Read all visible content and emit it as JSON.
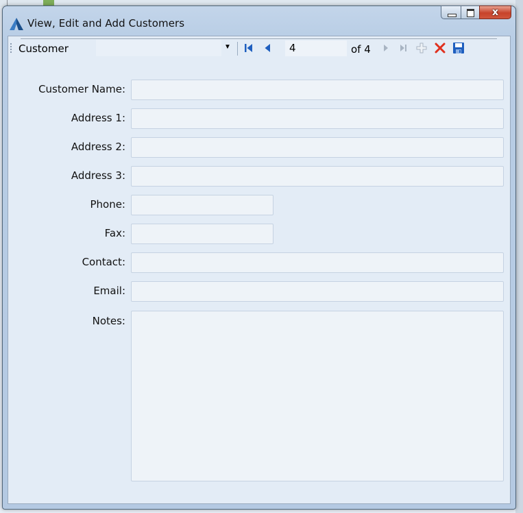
{
  "window": {
    "title": "View, Edit and Add Customers",
    "close_glyph": "x"
  },
  "toolbar": {
    "selector_value": "Customer",
    "position_value": "4",
    "of_label": "of 4",
    "icons": [
      "move-first-icon",
      "move-previous-icon",
      "move-next-icon",
      "move-last-icon",
      "add-new-icon",
      "delete-icon",
      "save-icon"
    ]
  },
  "form": {
    "customer_name": {
      "label": "Customer Name:",
      "value": ""
    },
    "address1": {
      "label": "Address 1:",
      "value": ""
    },
    "address2": {
      "label": "Address 2:",
      "value": ""
    },
    "address3": {
      "label": "Address 3:",
      "value": ""
    },
    "phone": {
      "label": "Phone:",
      "value": ""
    },
    "fax": {
      "label": "Fax:",
      "value": ""
    },
    "contact": {
      "label": "Contact:",
      "value": ""
    },
    "email": {
      "label": "Email:",
      "value": ""
    },
    "notes": {
      "label": "Notes:",
      "value": ""
    }
  },
  "colors": {
    "accent_blue": "#1f5fbf",
    "delete_red": "#e0301e",
    "disabled_gray": "#a8b4c2"
  }
}
